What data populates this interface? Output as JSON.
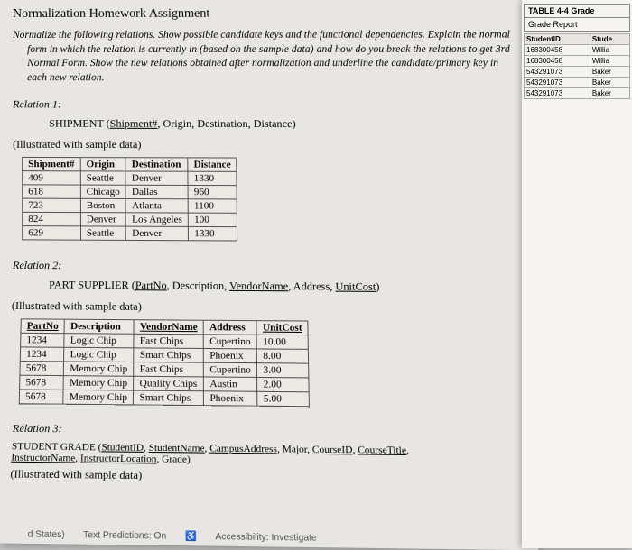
{
  "title": "Normalization Homework Assignment",
  "instructions": "Normalize the following relations. Show possible candidate keys and the functional dependencies. Explain the normal form in which the relation is currently in (based on the sample data) and how do you break the relations to get 3rd Normal Form. Show the new relations obtained after normalization and underline the candidate/primary key in each new relation.",
  "rel1": {
    "label": "Relation 1:",
    "schema_name": "SHIPMENT",
    "pk": "Shipment#",
    "attrs": ", Origin, Destination, Distance)",
    "illus": "(Illustrated with sample data)",
    "headers": [
      "Shipment#",
      "Origin",
      "Destination",
      "Distance"
    ],
    "rows": [
      [
        "409",
        "Seattle",
        "Denver",
        "1330"
      ],
      [
        "618",
        "Chicago",
        "Dallas",
        "960"
      ],
      [
        "723",
        "Boston",
        "Atlanta",
        "1100"
      ],
      [
        "824",
        "Denver",
        "Los Angeles",
        "100"
      ],
      [
        "629",
        "Seattle",
        "Denver",
        "1330"
      ]
    ]
  },
  "rel2": {
    "label": "Relation 2:",
    "schema_name": "PART SUPPLIER",
    "attrs_pre": "(",
    "pk1": "PartNo",
    "mid1": ", Description, ",
    "pk2": "VendorName",
    "mid2": ", Address, ",
    "pk3": "UnitCost",
    "end": ")",
    "illus": "(Illustrated with sample data)",
    "headers": [
      "PartNo",
      "Description",
      "VendorName",
      "Address",
      "UnitCost"
    ],
    "rows": [
      [
        "1234",
        "Logic Chip",
        "Fast Chips",
        "Cupertino",
        "10.00"
      ],
      [
        "1234",
        "Logic Chip",
        "Smart Chips",
        "Phoenix",
        "8.00"
      ],
      [
        "5678",
        "Memory Chip",
        "Fast Chips",
        "Cupertino",
        "3.00"
      ],
      [
        "5678",
        "Memory Chip",
        "Quality Chips",
        "Austin",
        "2.00"
      ],
      [
        "5678",
        "Memory Chip",
        "Smart Chips",
        "Phoenix",
        "5.00"
      ]
    ]
  },
  "rel3": {
    "label": "Relation 3:",
    "line1a": "STUDENT GRADE (",
    "u1": "StudentID",
    "line1b": ", ",
    "u2": "StudentName",
    "line1c": ", ",
    "u3": "CampusAddress",
    "line1d": ", Major, ",
    "u4": "CourseID",
    "line1e": ", ",
    "u5": "CourseTitle",
    "line1f": ",",
    "line2a": "InstructorName",
    "line2b": ", ",
    "u6": "InstructorLocation",
    "line2c": ", Grade)",
    "illus": "(Illustrated with sample data)"
  },
  "status": {
    "states": "d States)",
    "pred": "Text Predictions: On",
    "acc": "Accessibility: Investigate"
  },
  "side": {
    "hdr": "TABLE 4-4  Grade",
    "sub": "Grade Report",
    "cols": [
      "StudentID",
      "Stude"
    ],
    "rows": [
      [
        "168300458",
        "Willia"
      ],
      [
        "168300458",
        "Willia"
      ],
      [
        "543291073",
        "Baker"
      ],
      [
        "543291073",
        "Baker"
      ],
      [
        "543291073",
        "Baker"
      ]
    ]
  }
}
